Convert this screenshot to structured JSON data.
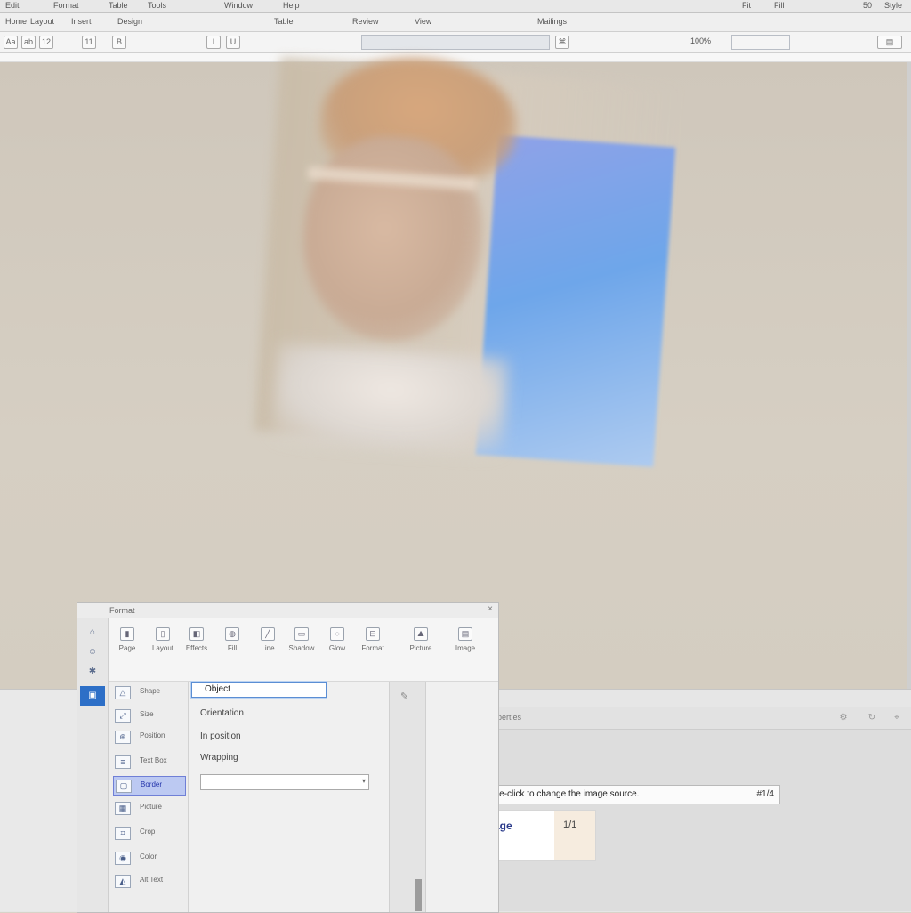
{
  "menubar": {
    "items": [
      "Edit",
      "Format",
      "Table",
      "Tools",
      "Window",
      "Help",
      "Fit",
      "Fill",
      "50",
      "Style"
    ]
  },
  "tabbar": {
    "items": [
      "Home",
      "Layout",
      "Insert",
      "Design",
      "Table",
      "Review",
      "View",
      "Mailings"
    ]
  },
  "toolbar": {
    "labels": [
      "Aa",
      "ab",
      "12",
      "11",
      "B",
      "I",
      "U"
    ],
    "zoom_text": "100%"
  },
  "dialog": {
    "title": "Format",
    "close": "×",
    "ribbon": [
      {
        "icon": "page-icon",
        "label": "Page"
      },
      {
        "icon": "layout-icon",
        "label": "Layout"
      },
      {
        "icon": "effects-icon",
        "label": "Effects"
      },
      {
        "icon": "fill-icon",
        "label": "Fill"
      },
      {
        "icon": "line-icon",
        "label": "Line"
      },
      {
        "icon": "shadow-icon",
        "label": "Shadow"
      },
      {
        "icon": "glow-icon",
        "label": "Glow"
      },
      {
        "icon": "format-icon",
        "label": "Format"
      },
      {
        "icon": "picture-icon",
        "label": "Picture"
      },
      {
        "icon": "image-icon",
        "label": "Image"
      }
    ],
    "navlist": [
      {
        "icon": "shape-icon",
        "label": "Shape"
      },
      {
        "icon": "size-icon",
        "label": "Size"
      },
      {
        "icon": "position-icon",
        "label": "Position"
      },
      {
        "icon": "text-icon",
        "label": "Text Box"
      },
      {
        "icon": "border-icon",
        "label": "Border"
      },
      {
        "icon": "picture-icon",
        "label": "Picture"
      },
      {
        "icon": "crop-icon",
        "label": "Crop"
      },
      {
        "icon": "color-icon",
        "label": "Color"
      },
      {
        "icon": "alt-text-icon",
        "label": "Alt Text"
      }
    ],
    "search_value": "Object",
    "options": [
      "Orientation",
      "In position",
      "Wrapping"
    ],
    "combo_value": ""
  },
  "right_pane": {
    "title": "Properties"
  },
  "message": {
    "text": "Double-click to change the image source.",
    "value": "#1/4"
  },
  "thumbnail": {
    "label": "Image",
    "right": "1/1"
  },
  "colors": {
    "accent": "#2d6fc7",
    "selection": "#bcc9f2"
  }
}
